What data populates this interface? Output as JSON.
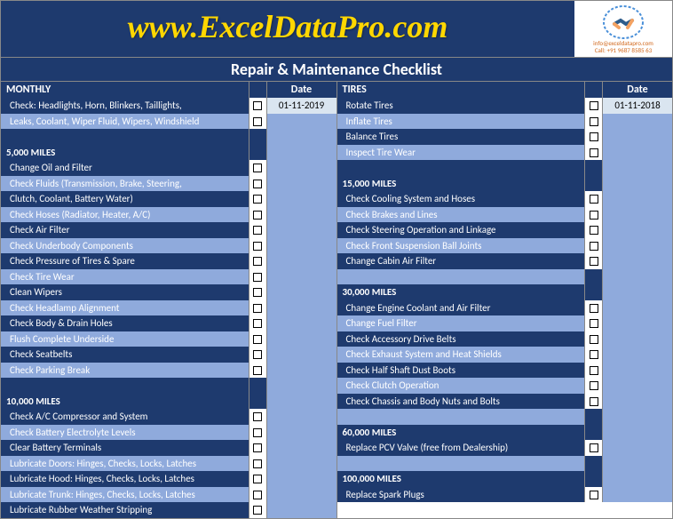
{
  "header": {
    "website": "www.ExcelDataPro.com",
    "info_email": "info@exceldatapro.com",
    "info_phone": "Call: +91 9687 8585 63"
  },
  "title": "Repair & Maintenance Checklist",
  "left": {
    "date_label": "Date",
    "date_value": "01-11-2019",
    "sections": [
      {
        "header": "MONTHLY",
        "rows": [
          {
            "label": "Check:  Headlights, Horn, Blinkers, Taillights,",
            "check": true,
            "shade": "dark"
          },
          {
            "label": "Leaks, Coolant, Wiper Fluid, Wipers, Windshield",
            "check": true,
            "shade": "light"
          },
          {
            "label": "",
            "check": false,
            "shade": "dark",
            "empty": true
          }
        ]
      },
      {
        "header": "5,000 MILES",
        "rows": [
          {
            "label": "Change Oil and Filter",
            "check": true,
            "shade": "dark"
          },
          {
            "label": "Check Fluids (Transmission, Brake, Steering,",
            "check": true,
            "shade": "light"
          },
          {
            "label": "Clutch, Coolant, Battery Water)",
            "check": true,
            "shade": "dark"
          },
          {
            "label": "Check Hoses (Radiator, Heater, A/C)",
            "check": true,
            "shade": "light"
          },
          {
            "label": "Check Air Filter",
            "check": true,
            "shade": "dark"
          },
          {
            "label": "Check Underbody Components",
            "check": true,
            "shade": "light"
          },
          {
            "label": "Check Pressure of Tires & Spare",
            "check": true,
            "shade": "dark"
          },
          {
            "label": "Check Tire Wear",
            "check": true,
            "shade": "light"
          },
          {
            "label": "Clean Wipers",
            "check": true,
            "shade": "dark"
          },
          {
            "label": "Check Headlamp Alignment",
            "check": true,
            "shade": "light"
          },
          {
            "label": "Check Body & Drain Holes",
            "check": true,
            "shade": "dark"
          },
          {
            "label": "Flush Complete Underside",
            "check": true,
            "shade": "light"
          },
          {
            "label": "Check Seatbelts",
            "check": true,
            "shade": "dark"
          },
          {
            "label": "Check Parking Break",
            "check": true,
            "shade": "light"
          },
          {
            "label": "",
            "check": false,
            "shade": "dark",
            "empty": true
          }
        ]
      },
      {
        "header": "10,000 MILES",
        "rows": [
          {
            "label": "Check A/C Compressor and System",
            "check": true,
            "shade": "dark"
          },
          {
            "label": "Check Battery Electrolyte Levels",
            "check": true,
            "shade": "light"
          },
          {
            "label": "Clear Battery Terminals",
            "check": true,
            "shade": "dark"
          },
          {
            "label": "Lubricate Doors:  Hinges, Checks, Locks, Latches",
            "check": true,
            "shade": "light"
          },
          {
            "label": "Lubricate Hood:  Hinges, Checks, Locks, Latches",
            "check": true,
            "shade": "dark"
          },
          {
            "label": "Lubricate Trunk:  Hinges, Checks, Locks, Latches",
            "check": true,
            "shade": "light"
          },
          {
            "label": "Lubricate Rubber Weather Stripping",
            "check": true,
            "shade": "dark"
          }
        ]
      }
    ]
  },
  "right": {
    "date_label": "Date",
    "date_value": "01-11-2018",
    "sections": [
      {
        "header": "TIRES",
        "rows": [
          {
            "label": "Rotate Tires",
            "check": true,
            "shade": "dark"
          },
          {
            "label": "Inflate Tires",
            "check": true,
            "shade": "light"
          },
          {
            "label": "Balance Tires",
            "check": true,
            "shade": "dark"
          },
          {
            "label": "Inspect Tire Wear",
            "check": true,
            "shade": "light"
          },
          {
            "label": "",
            "check": false,
            "shade": "dark",
            "empty": true
          }
        ]
      },
      {
        "header": "15,000 MILES",
        "rows": [
          {
            "label": "Check Cooling System and Hoses",
            "check": true,
            "shade": "dark"
          },
          {
            "label": "Check Brakes and Lines",
            "check": true,
            "shade": "light"
          },
          {
            "label": "Check Steering Operation and Linkage",
            "check": true,
            "shade": "dark"
          },
          {
            "label": "Check Front Suspension Ball Joints",
            "check": true,
            "shade": "light"
          },
          {
            "label": "Change Cabin Air Filter",
            "check": true,
            "shade": "dark"
          },
          {
            "label": "",
            "check": false,
            "shade": "light",
            "empty": true
          }
        ]
      },
      {
        "header": "30,000 MILES",
        "rows": [
          {
            "label": "Change Engine Coolant and Air Filter",
            "check": true,
            "shade": "dark"
          },
          {
            "label": "Change Fuel Filter",
            "check": true,
            "shade": "light"
          },
          {
            "label": "Check Accessory Drive Belts",
            "check": true,
            "shade": "dark"
          },
          {
            "label": "Check Exhaust System and Heat Shields",
            "check": true,
            "shade": "light"
          },
          {
            "label": "Check Half Shaft Dust Boots",
            "check": true,
            "shade": "dark"
          },
          {
            "label": "Check Clutch Operation",
            "check": true,
            "shade": "light"
          },
          {
            "label": "Check Chassis and Body Nuts and Bolts",
            "check": true,
            "shade": "dark"
          },
          {
            "label": "",
            "check": false,
            "shade": "light",
            "empty": true
          }
        ]
      },
      {
        "header": "60,000 MILES",
        "rows": [
          {
            "label": "Replace PCV Valve (free from Dealership)",
            "check": true,
            "shade": "dark"
          },
          {
            "label": "",
            "check": false,
            "shade": "light",
            "empty": true
          }
        ]
      },
      {
        "header": "100,000 MILES",
        "rows": [
          {
            "label": "Replace Spark Plugs",
            "check": true,
            "shade": "dark"
          }
        ]
      }
    ]
  }
}
